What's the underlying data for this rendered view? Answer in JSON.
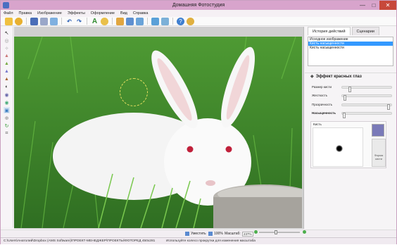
{
  "window": {
    "title": "Домашняя Фотостудия",
    "controls": {
      "minimize": "—",
      "maximize": "□",
      "close": "✕"
    }
  },
  "menu": [
    "Файл",
    "Правка",
    "Изображение",
    "Эффекты",
    "Оформление",
    "Вид",
    "Справка"
  ],
  "right_panel": {
    "tabs": [
      "История действий",
      "Сценарии"
    ],
    "history": [
      "Исходное изображение",
      "Кисть насыщенности",
      "Кисть насыщенности"
    ],
    "effect_title": "Эффект красных глаз",
    "controls": [
      {
        "label": "Размер кисти",
        "value": 0.14
      },
      {
        "label": "Жесткость",
        "value": 0.03
      },
      {
        "label": "Прозрачность",
        "value": 0.97
      },
      {
        "label": "Насыщенность",
        "value": 0.02
      }
    ],
    "brush_label": "Кисть",
    "brush_color": "#7a7ab8",
    "form_label": "Форма кисти"
  },
  "bottom": {
    "fit": "Уместить",
    "zoom100": "100%",
    "zoom_label": "Масштаб:",
    "zoom_value": "237%"
  },
  "status": {
    "path": "C:\\Users\\Анатолий\\Dropbox (AMS Software)\\ПРОЕКТ-МЕНЕДЖЕР\\ПРОЕКТЫ\\ФОТОРЕД 450x281",
    "hint": "Используйте колесо прокрутки для изменения масштаба"
  },
  "colors": {
    "accent": "#3399ff",
    "titlebar": "#d8a4cc",
    "grass": "#3f8a2a"
  }
}
